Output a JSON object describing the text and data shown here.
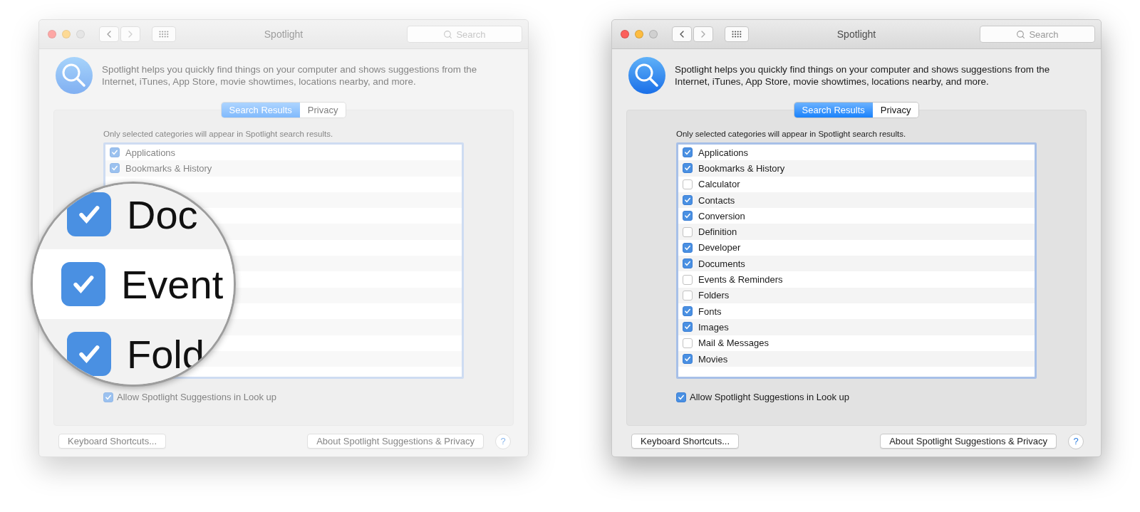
{
  "windows": [
    {
      "dimmed": true,
      "title": "Spotlight",
      "search": {
        "placeholder": "Search"
      },
      "description": "Spotlight helps you quickly find things on your computer and shows suggestions from the Internet, iTunes, App Store, movie showtimes, locations nearby, and more.",
      "tabs": [
        {
          "label": "Search Results",
          "selected": true
        },
        {
          "label": "Privacy",
          "selected": false
        }
      ],
      "caption": "Only selected categories will appear in Spotlight search results.",
      "categories": [
        {
          "label": "Applications",
          "checked": true
        },
        {
          "label": "Bookmarks & History",
          "checked": true
        }
      ],
      "allow_suggestions": {
        "label": "Allow Spotlight Suggestions in Look up",
        "checked": true
      },
      "buttons": [
        "Keyboard Shortcuts...",
        "About Spotlight Suggestions & Privacy"
      ],
      "help": "?",
      "magnifier": {
        "items": [
          {
            "label": "Doc",
            "checked": true
          },
          {
            "label": "Event",
            "checked": true
          },
          {
            "label": "Fold",
            "checked": true
          }
        ]
      }
    },
    {
      "dimmed": false,
      "title": "Spotlight",
      "search": {
        "placeholder": "Search"
      },
      "description": "Spotlight helps you quickly find things on your computer and shows suggestions from the Internet, iTunes, App Store, movie showtimes, locations nearby, and more.",
      "tabs": [
        {
          "label": "Search Results",
          "selected": true
        },
        {
          "label": "Privacy",
          "selected": false
        }
      ],
      "caption": "Only selected categories will appear in Spotlight search results.",
      "categories": [
        {
          "label": "Applications",
          "checked": true
        },
        {
          "label": "Bookmarks & History",
          "checked": true
        },
        {
          "label": "Calculator",
          "checked": false
        },
        {
          "label": "Contacts",
          "checked": true
        },
        {
          "label": "Conversion",
          "checked": true
        },
        {
          "label": "Definition",
          "checked": false
        },
        {
          "label": "Developer",
          "checked": true
        },
        {
          "label": "Documents",
          "checked": true
        },
        {
          "label": "Events & Reminders",
          "checked": false
        },
        {
          "label": "Folders",
          "checked": false
        },
        {
          "label": "Fonts",
          "checked": true
        },
        {
          "label": "Images",
          "checked": true
        },
        {
          "label": "Mail & Messages",
          "checked": false
        },
        {
          "label": "Movies",
          "checked": true
        }
      ],
      "allow_suggestions": {
        "label": "Allow Spotlight Suggestions in Look up",
        "checked": true
      },
      "buttons": [
        "Keyboard Shortcuts...",
        "About Spotlight Suggestions & Privacy"
      ],
      "help": "?"
    }
  ]
}
